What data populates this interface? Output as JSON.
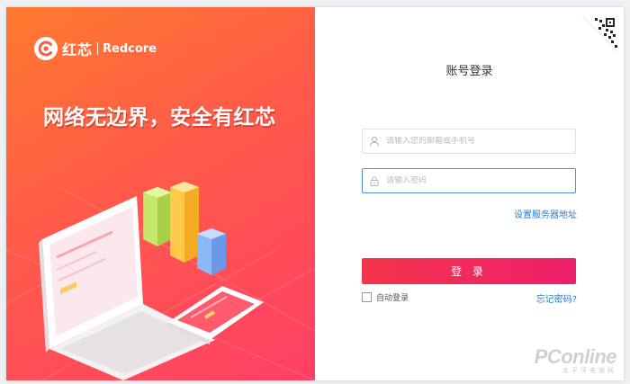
{
  "brand": {
    "name_cn": "红芯",
    "name_en": "Redcore"
  },
  "slogan": "网络无边界，安全有红芯",
  "login": {
    "title": "账号登录",
    "username_placeholder": "请输入您的邮箱或手机号",
    "password_placeholder": "请输入密码",
    "server_link": "设置服务器地址",
    "submit_label": "登 录",
    "auto_login_label": "自动登录",
    "auto_login_checked": false,
    "forgot_link": "忘记密码?"
  },
  "watermark": {
    "main": "PConline",
    "sub": "太平洋电脑网"
  },
  "colors": {
    "accent": "#ee2b5b",
    "link": "#2a7ad2",
    "gradient_start": "#ff7a2e",
    "gradient_end": "#ff3f66"
  },
  "icons": {
    "user": "user-icon",
    "lock": "lock-icon",
    "qr": "qr-code-icon"
  }
}
